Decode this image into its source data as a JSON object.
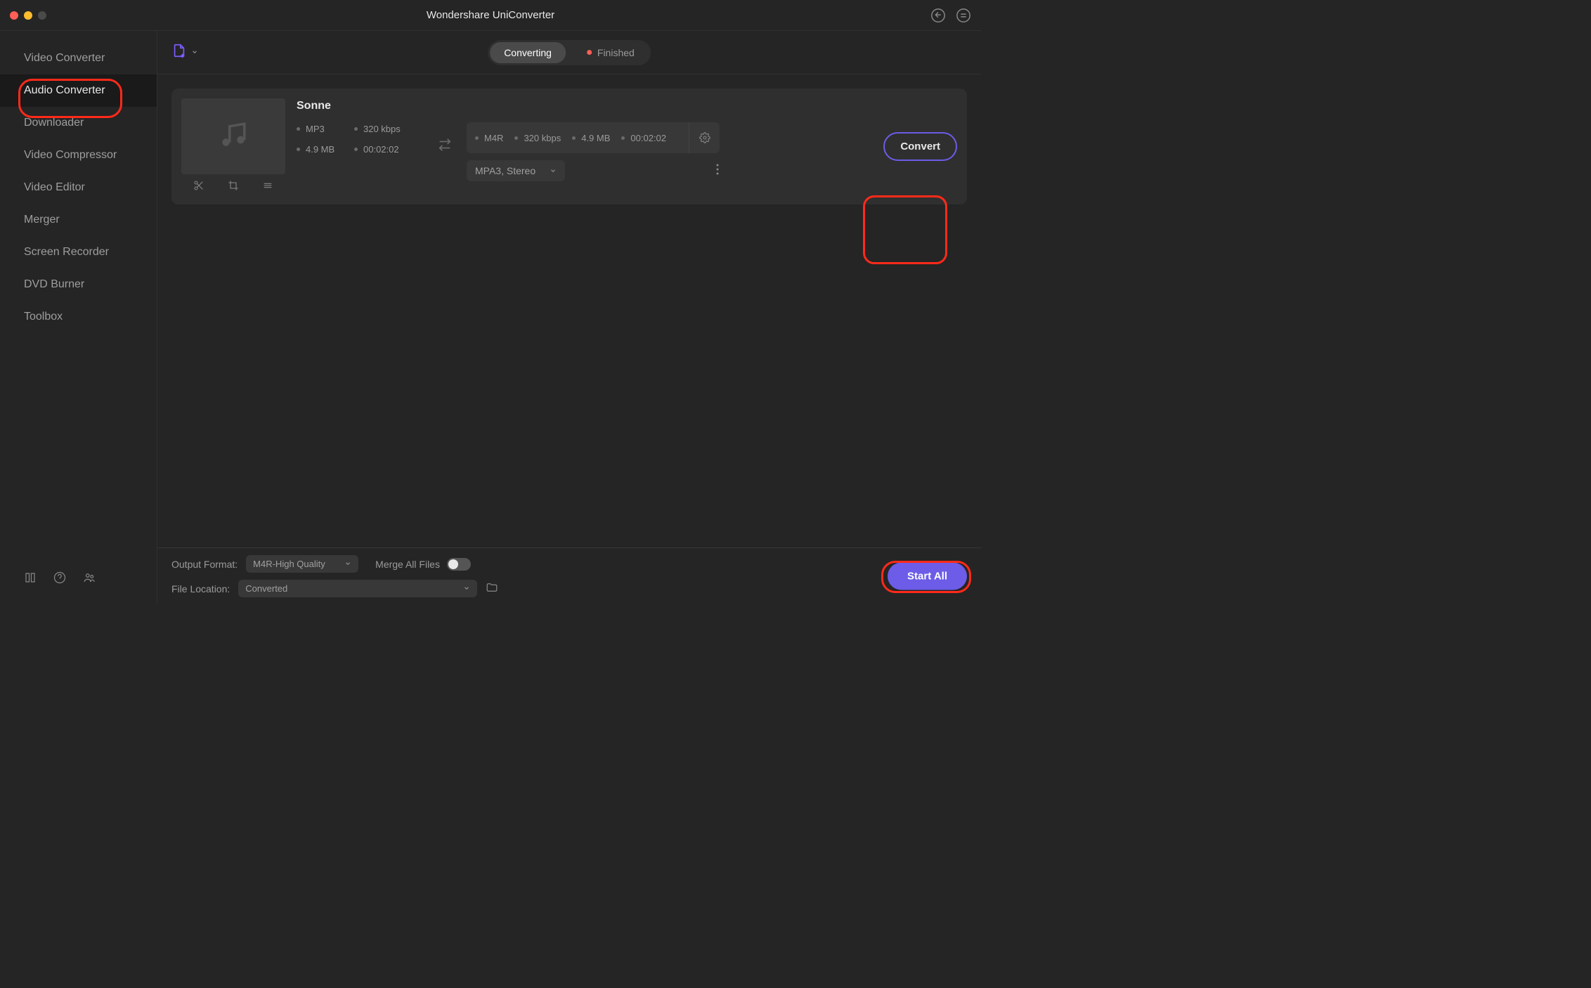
{
  "title": "Wondershare UniConverter",
  "sidebar": {
    "items": [
      {
        "label": "Video Converter"
      },
      {
        "label": "Audio Converter"
      },
      {
        "label": "Downloader"
      },
      {
        "label": "Video Compressor"
      },
      {
        "label": "Video Editor"
      },
      {
        "label": "Merger"
      },
      {
        "label": "Screen Recorder"
      },
      {
        "label": "DVD Burner"
      },
      {
        "label": "Toolbox"
      }
    ],
    "active_index": 1
  },
  "tabs": {
    "converting": "Converting",
    "finished": "Finished"
  },
  "file": {
    "name": "Sonne",
    "src": {
      "format": "MP3",
      "bitrate": "320 kbps",
      "size": "4.9 MB",
      "duration": "00:02:02"
    },
    "dest": {
      "format": "M4R",
      "bitrate": "320 kbps",
      "size": "4.9 MB",
      "duration": "00:02:02"
    },
    "channel": "MPA3, Stereo",
    "convert_label": "Convert"
  },
  "bottom": {
    "output_format_label": "Output Format:",
    "output_format_value": "M4R-High Quality",
    "merge_label": "Merge All Files",
    "file_location_label": "File Location:",
    "file_location_value": "Converted",
    "start_all_label": "Start All"
  }
}
